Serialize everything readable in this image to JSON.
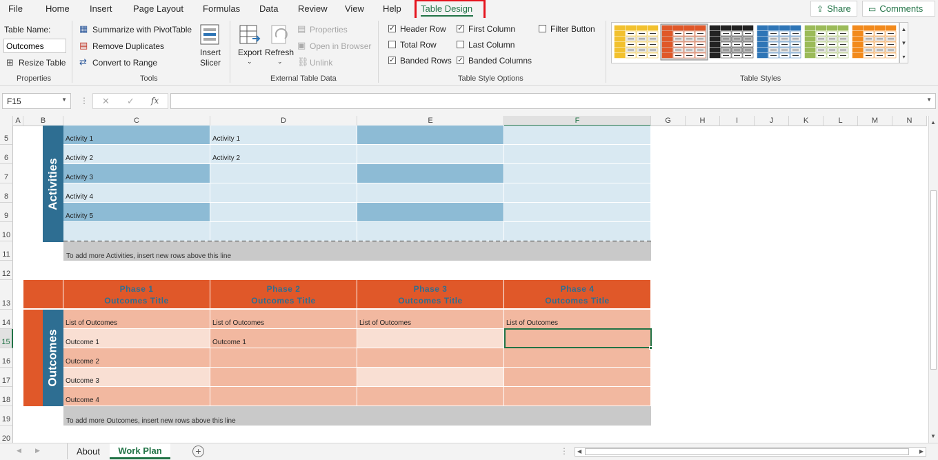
{
  "menu": {
    "tabs": [
      "File",
      "Home",
      "Insert",
      "Page Layout",
      "Formulas",
      "Data",
      "Review",
      "View",
      "Help",
      "Table Design"
    ],
    "share_label": "Share",
    "comments_label": "Comments"
  },
  "ribbon": {
    "properties": {
      "table_name_label": "Table Name:",
      "table_name_value": "Outcomes",
      "resize_label": "Resize Table",
      "group_label": "Properties"
    },
    "tools": {
      "summarize_label": "Summarize with PivotTable",
      "remove_dup_label": "Remove Duplicates",
      "convert_label": "Convert to Range",
      "slicer_label_1": "Insert",
      "slicer_label_2": "Slicer",
      "group_label": "Tools"
    },
    "external": {
      "export_label": "Export",
      "refresh_label": "Refresh",
      "properties_label": "Properties",
      "open_browser_label": "Open in Browser",
      "unlink_label": "Unlink",
      "group_label": "External Table Data"
    },
    "style_options": {
      "header_row": "Header Row",
      "total_row": "Total Row",
      "banded_rows": "Banded Rows",
      "first_column": "First Column",
      "last_column": "Last Column",
      "banded_columns": "Banded Columns",
      "filter_button": "Filter Button",
      "group_label": "Table Style Options"
    },
    "table_styles": {
      "group_label": "Table Styles",
      "swatches": [
        "#f2c12e",
        "#e05829",
        "#222222",
        "#2e75b6",
        "#9bbb59",
        "#f28a1c"
      ]
    }
  },
  "formula_bar": {
    "name_box": "F15",
    "fx": "fx",
    "cancel": "✕",
    "enter": "✓",
    "value": ""
  },
  "grid": {
    "columns": [
      "A",
      "B",
      "C",
      "D",
      "E",
      "F",
      "G",
      "H",
      "I",
      "J",
      "K",
      "L",
      "M",
      "N"
    ],
    "rows": [
      "5",
      "6",
      "7",
      "8",
      "9",
      "10",
      "11",
      "12",
      "13",
      "14",
      "15",
      "16",
      "17",
      "18",
      "19",
      "20"
    ],
    "activities_label": "Activities",
    "outcomes_label": "Outcomes",
    "activities": {
      "C": [
        "Activity 1",
        "Activity 2",
        "Activity 3",
        "Activity 4",
        "Activity 5",
        ""
      ],
      "D": [
        "Activity 1",
        "Activity 2",
        "",
        "",
        "",
        ""
      ]
    },
    "activities_note": "To add more Activities, insert new rows above this line",
    "phases": [
      {
        "line1": "Phase 1",
        "line2": "Outcomes Title"
      },
      {
        "line1": "Phase 2",
        "line2": "Outcomes Title"
      },
      {
        "line1": "Phase 3",
        "line2": "Outcomes Title"
      },
      {
        "line1": "Phase 4",
        "line2": "Outcomes Title"
      }
    ],
    "outcomes": {
      "C": [
        "List of Outcomes",
        "Outcome 1",
        "Outcome 2",
        "Outcome 3",
        "Outcome 4"
      ],
      "D": [
        "List of Outcomes",
        "Outcome 1",
        "",
        "",
        ""
      ],
      "E": [
        "List of Outcomes",
        "",
        "",
        "",
        ""
      ],
      "F": [
        "List of Outcomes",
        "",
        "",
        "",
        ""
      ]
    },
    "outcomes_note": "To add more Outcomes, insert new rows above this line"
  },
  "sheets": {
    "tabs": [
      "About",
      "Work Plan"
    ],
    "active": "Work Plan",
    "add": "+"
  }
}
